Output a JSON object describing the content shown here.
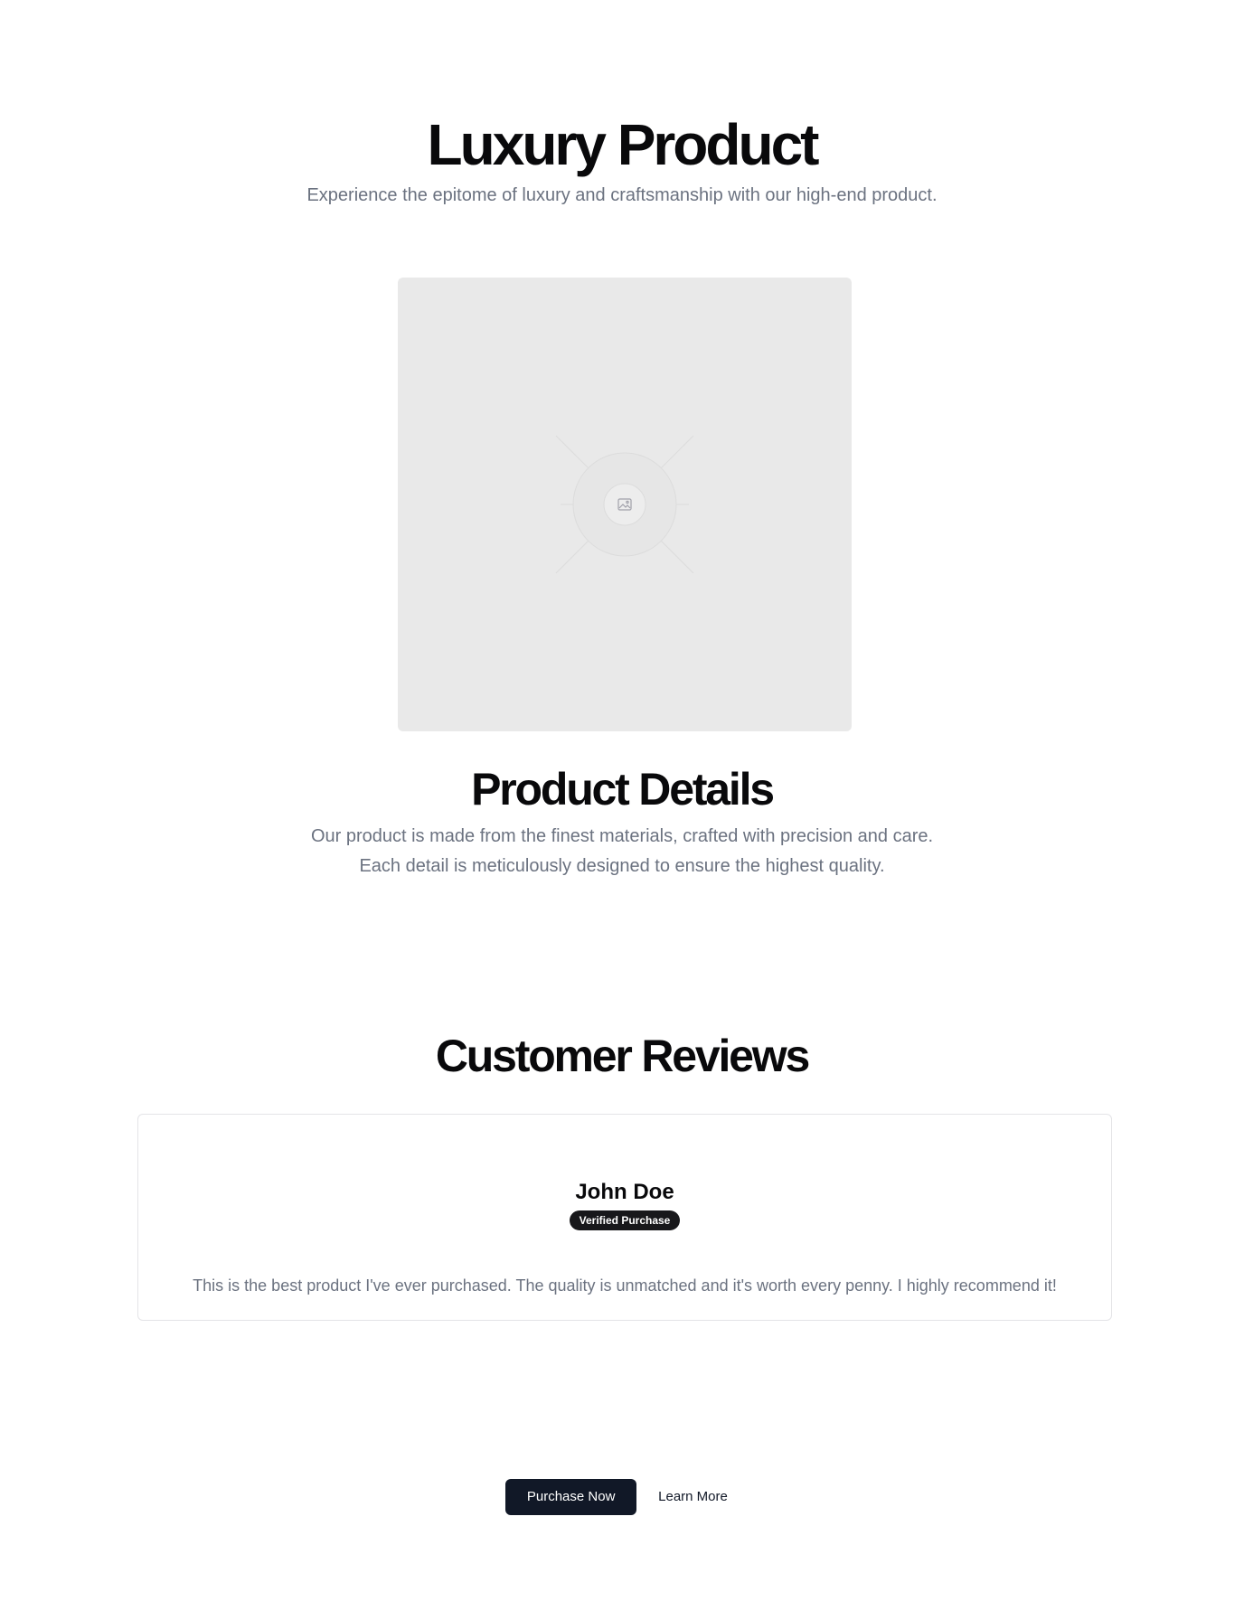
{
  "hero": {
    "title": "Luxury Product",
    "subtitle": "Experience the epitome of luxury and craftsmanship with our high-end product."
  },
  "product_image": {
    "icon": "image-placeholder-icon",
    "background": "#e9e9e9"
  },
  "details": {
    "title": "Product Details",
    "text": "Our product is made from the finest materials, crafted with precision and care. Each detail is meticulously designed to ensure the highest quality."
  },
  "reviews": {
    "title": "Customer Reviews",
    "items": [
      {
        "name": "John Doe",
        "badge": "Verified Purchase",
        "text": "This is the best product I've ever purchased. The quality is unmatched and it's worth every penny. I highly recommend it!"
      }
    ]
  },
  "actions": {
    "primary_label": "Purchase Now",
    "secondary_label": "Learn More"
  },
  "colors": {
    "primary_button": "#111827",
    "badge": "#18181b",
    "muted_text": "#6b7280",
    "heading": "#09090b"
  }
}
